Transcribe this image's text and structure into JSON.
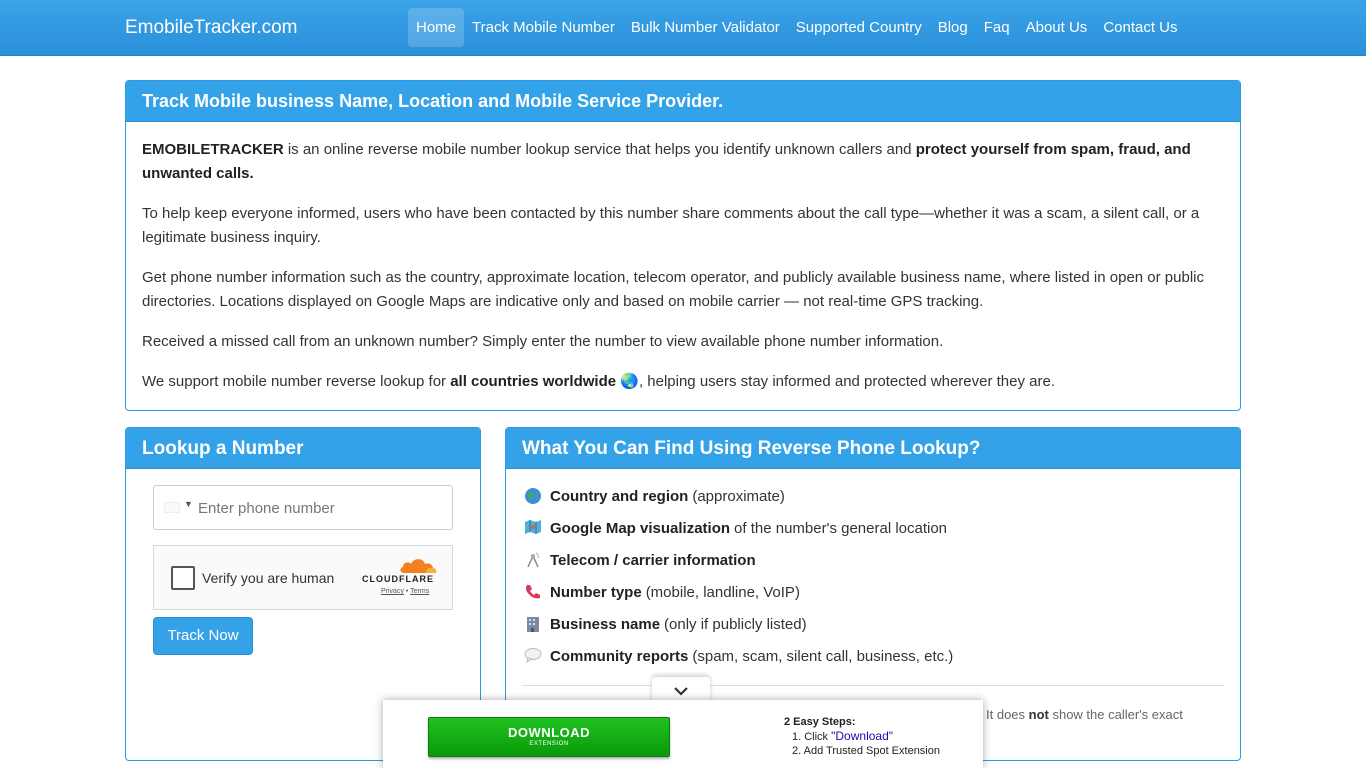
{
  "nav": {
    "brand": "EmobileTracker.com",
    "items": [
      "Home",
      "Track Mobile Number",
      "Bulk Number Validator",
      "Supported Country",
      "Blog",
      "Faq",
      "About Us",
      "Contact Us"
    ]
  },
  "intro": {
    "title": "Track Mobile business Name, Location and Mobile Service Provider.",
    "p1_brand": "EMOBILETRACKER",
    "p1_text": " is an online reverse mobile number lookup service that helps you identify unknown callers and ",
    "p1_strong": "protect yourself from spam, fraud, and unwanted calls.",
    "p2": "To help keep everyone informed, users who have been contacted by this number share comments about the call type—whether it was a scam, a silent call, or a legitimate business inquiry.",
    "p3": "Get phone number information such as the country, approximate location, telecom operator, and publicly available business name, where listed in open or public directories. Locations displayed on Google Maps are indicative only and based on mobile carrier — not real-time GPS tracking.",
    "p4": "Received a missed call from an unknown number? Simply enter the number to view available phone number information.",
    "p5_pre": "We support mobile number reverse lookup for ",
    "p5_strong": "all countries worldwide",
    "p5_emoji": "🌏",
    "p5_post": ", helping users stay informed and protected wherever they are."
  },
  "lookup": {
    "title": "Lookup a Number",
    "phone_placeholder": "Enter phone number",
    "captcha_label": "Verify you are human",
    "captcha_brand": "CLOUDFLARE",
    "captcha_privacy": "Privacy",
    "captcha_sep": " • ",
    "captcha_terms": "Terms",
    "button": "Track Now"
  },
  "features": {
    "title": "What You Can Find Using Reverse Phone Lookup?",
    "items": [
      {
        "icon": "globe-icon",
        "strong": "Country and region",
        "rest": "(approximate)"
      },
      {
        "icon": "map-icon",
        "strong": "Google Map visualization",
        "rest": "of the number's general location"
      },
      {
        "icon": "antenna-icon",
        "strong": "Telecom / carrier information",
        "rest": ""
      },
      {
        "icon": "phone-icon",
        "strong": "Number type",
        "rest": "(mobile, landline, VoIP)"
      },
      {
        "icon": "building-icon",
        "strong": "Business name",
        "rest": "(only if publicly listed)"
      },
      {
        "icon": "speech-bubble-icon",
        "strong": "Community reports",
        "rest": "(spam, scam, silent call, business, etc.)"
      }
    ],
    "note_pre": "It does ",
    "note_strong": "not",
    "note_post": " show the caller's exact"
  },
  "ad": {
    "button_main": "DOWNLOAD",
    "button_sub": "EXTENSION",
    "steps_title": "2 Easy Steps:",
    "step1_pre": "1. Click ",
    "step1_quote": "\"Download\"",
    "step2": "2. Add Trusted Spot Extension"
  },
  "colors": {
    "primary": "#33a2e8",
    "download_green": "#12b012"
  }
}
